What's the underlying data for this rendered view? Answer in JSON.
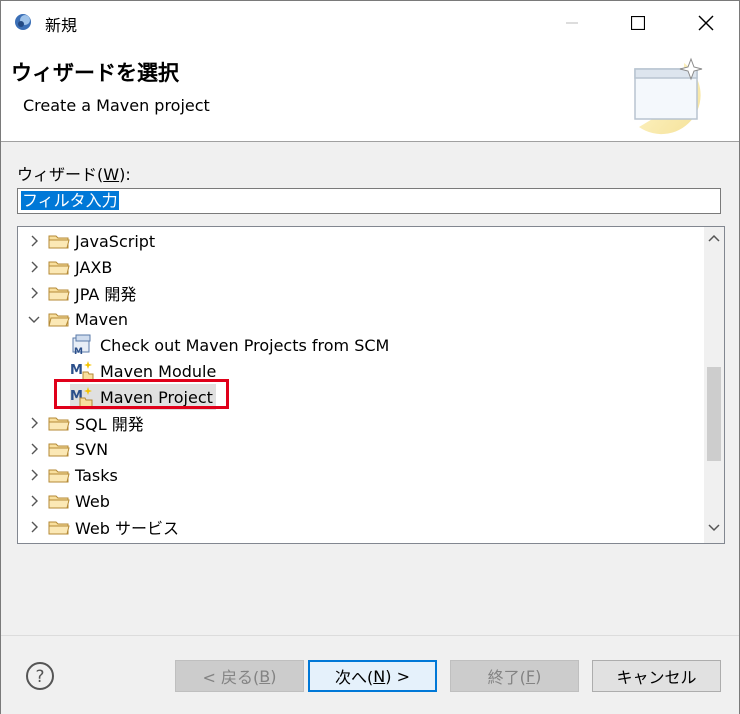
{
  "window": {
    "title": "新規"
  },
  "header": {
    "title": "ウィザードを選択",
    "subtitle": "Create a Maven project"
  },
  "filter": {
    "label_prefix": "ウィザード(",
    "label_mnemonic": "W",
    "label_suffix": "):",
    "value": "フィルタ入力"
  },
  "tree": {
    "items": [
      {
        "label": "JavaScript",
        "kind": "folder",
        "expanded": false
      },
      {
        "label": "JAXB",
        "kind": "folder",
        "expanded": false
      },
      {
        "label": "JPA 開発",
        "kind": "folder",
        "expanded": false
      },
      {
        "label": "Maven",
        "kind": "folder",
        "expanded": true
      },
      {
        "label": "Check out Maven Projects from SCM",
        "kind": "wizard",
        "icon": "maven-checkout-icon"
      },
      {
        "label": "Maven Module",
        "kind": "wizard",
        "icon": "maven-module-icon"
      },
      {
        "label": "Maven Project",
        "kind": "wizard",
        "icon": "maven-project-icon",
        "selected": true
      },
      {
        "label": "SQL 開発",
        "kind": "folder",
        "expanded": false
      },
      {
        "label": "SVN",
        "kind": "folder",
        "expanded": false
      },
      {
        "label": "Tasks",
        "kind": "folder",
        "expanded": false
      },
      {
        "label": "Web",
        "kind": "folder",
        "expanded": false
      },
      {
        "label": "Web サービス",
        "kind": "folder",
        "expanded": false
      }
    ]
  },
  "buttons": {
    "back": {
      "prefix": "< 戻る(",
      "mnemonic": "B",
      "suffix": ")",
      "enabled": false
    },
    "next": {
      "prefix": "次へ(",
      "mnemonic": "N",
      "suffix": ") >",
      "enabled": true,
      "default": true
    },
    "finish": {
      "prefix": "終了(",
      "mnemonic": "F",
      "suffix": ")",
      "enabled": false
    },
    "cancel": {
      "label": "キャンセル",
      "enabled": true
    }
  },
  "colors": {
    "selection": "#0078d7",
    "annotation_box": "#e0001a",
    "folder": "#dcb05c"
  }
}
